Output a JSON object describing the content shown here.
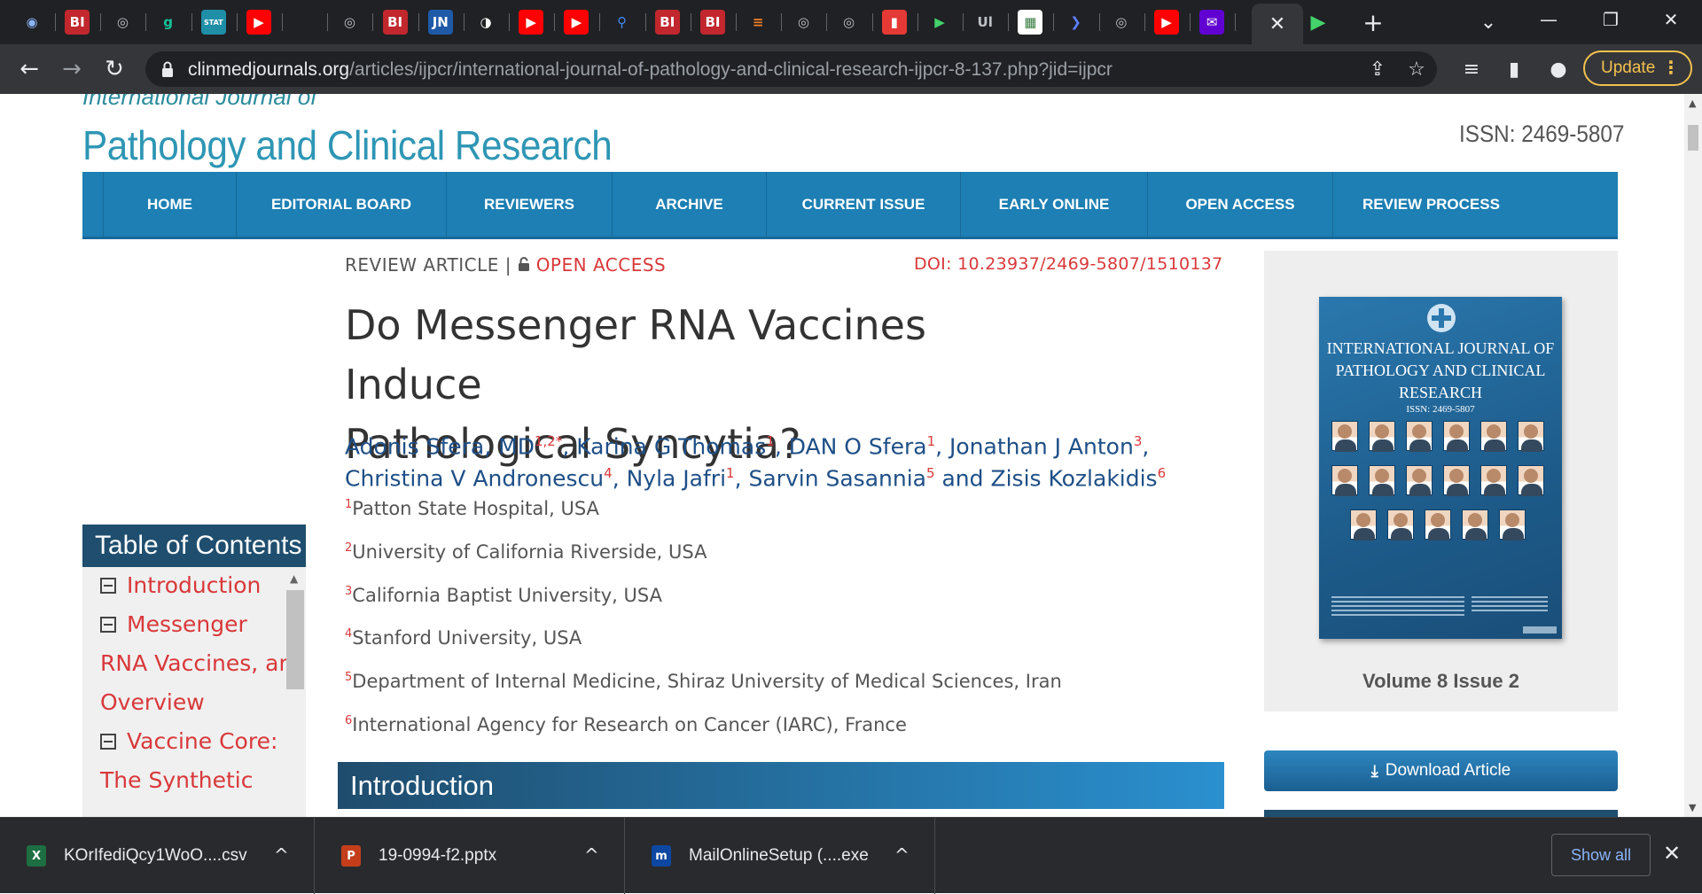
{
  "browser": {
    "tabs": [
      {
        "icon": "globe-icon",
        "glyph": "◉",
        "bg": "#202124",
        "fg": "#8ab4f8"
      },
      {
        "icon": "bi-icon",
        "glyph": "BI",
        "bg": "#c2272d",
        "fg": "#ffffff"
      },
      {
        "icon": "globe-icon",
        "glyph": "◎",
        "bg": "#202124",
        "fg": "#bdc1c6"
      },
      {
        "icon": "g-icon",
        "glyph": "g",
        "bg": "#202124",
        "fg": "#15c39a"
      },
      {
        "icon": "stat-icon",
        "glyph": "STAT",
        "bg": "#1f8fa8",
        "fg": "#ffffff"
      },
      {
        "icon": "youtube-icon",
        "glyph": "▶",
        "bg": "#ff0000",
        "fg": "#ffffff"
      },
      {
        "icon": "blank-icon",
        "glyph": "",
        "bg": "#202124",
        "fg": "#ffffff"
      },
      {
        "icon": "globe-icon",
        "glyph": "◎",
        "bg": "#202124",
        "fg": "#bdc1c6"
      },
      {
        "icon": "bi-icon",
        "glyph": "BI",
        "bg": "#c2272d",
        "fg": "#ffffff"
      },
      {
        "icon": "jn-icon",
        "glyph": "JN",
        "bg": "#1e5aa8",
        "fg": "#ffffff"
      },
      {
        "icon": "circle-icon",
        "glyph": "◑",
        "bg": "#202124",
        "fg": "#ffffff"
      },
      {
        "icon": "youtube-icon",
        "glyph": "▶",
        "bg": "#ff0000",
        "fg": "#ffffff"
      },
      {
        "icon": "youtube-icon",
        "glyph": "▶",
        "bg": "#ff0000",
        "fg": "#ffffff"
      },
      {
        "icon": "search-icon",
        "glyph": "⚲",
        "bg": "#202124",
        "fg": "#4285f4"
      },
      {
        "icon": "bi-icon",
        "glyph": "BI",
        "bg": "#c2272d",
        "fg": "#ffffff"
      },
      {
        "icon": "bi-icon",
        "glyph": "BI",
        "bg": "#c2272d",
        "fg": "#ffffff"
      },
      {
        "icon": "stack-icon",
        "glyph": "≡",
        "bg": "#202124",
        "fg": "#f48024"
      },
      {
        "icon": "globe-icon",
        "glyph": "◎",
        "bg": "#202124",
        "fg": "#bdc1c6"
      },
      {
        "icon": "globe-icon",
        "glyph": "◎",
        "bg": "#202124",
        "fg": "#bdc1c6"
      },
      {
        "icon": "mic-icon",
        "glyph": "▮",
        "bg": "#e53935",
        "fg": "#ffffff"
      },
      {
        "icon": "play-icon",
        "glyph": "▶",
        "bg": "#202124",
        "fg": "#43d36a"
      },
      {
        "icon": "ul-icon",
        "glyph": "Ul",
        "bg": "#202124",
        "fg": "#bdc1c6"
      },
      {
        "icon": "grid-icon",
        "glyph": "▦",
        "bg": "#ffffff",
        "fg": "#3a7d44"
      },
      {
        "icon": "arrow-icon",
        "glyph": "❯",
        "bg": "#202124",
        "fg": "#5b7fff"
      },
      {
        "icon": "globe-icon",
        "glyph": "◎",
        "bg": "#202124",
        "fg": "#bdc1c6"
      },
      {
        "icon": "youtube-icon",
        "glyph": "▶",
        "bg": "#ff0000",
        "fg": "#ffffff"
      },
      {
        "icon": "yahoo-icon",
        "glyph": "✉",
        "bg": "#6001d2",
        "fg": "#ffffff"
      }
    ],
    "active_tab_close": "✕",
    "after_tab_icon": {
      "icon": "play-icon",
      "glyph": "▶"
    },
    "new_tab": "+",
    "tab_search": "⌄",
    "minimize": "—",
    "restore": "❐",
    "close": "✕",
    "back": "←",
    "forward": "→",
    "reload": "↻",
    "url_host": "clinmedjournals.org",
    "url_path": "/articles/ijpcr/international-journal-of-pathology-and-clinical-research-ijpcr-8-137.php?jid=ijpcr",
    "share": "⇪",
    "bookmark": "☆",
    "media": "≡",
    "sidepanel": "▮",
    "profile": "●",
    "update_label": "Update",
    "update_menu": "⋮"
  },
  "page": {
    "journal_pre": "International Journal of",
    "journal_title": "Pathology and Clinical Research",
    "issn": "ISSN: 2469-5807",
    "nav": [
      "HOME",
      "EDITORIAL BOARD",
      "REVIEWERS",
      "ARCHIVE",
      "CURRENT ISSUE",
      "EARLY ONLINE",
      "OPEN ACCESS",
      "REVIEW PROCESS"
    ],
    "article_type": "REVIEW ARTICLE | ",
    "open_access": "OPEN ACCESS",
    "doi": "DOI: 10.23937/2469-5807/1510137",
    "title_line1": "Do Messenger RNA Vaccines Induce",
    "title_line2": "Pathological Syncytia?",
    "authors": [
      {
        "name": "Adonis Sfera, MD",
        "sup": "1,2*",
        "sep": ", "
      },
      {
        "name": "Karina G Thomas",
        "sup": "1",
        "sep": ", "
      },
      {
        "name": "DAN O Sfera",
        "sup": "1",
        "sep": ", "
      },
      {
        "name": "Jonathan J Anton",
        "sup": "3",
        "sep": ", "
      },
      {
        "name": "Christina V Andronescu",
        "sup": "4",
        "sep": ", "
      },
      {
        "name": "Nyla Jafri",
        "sup": "1",
        "sep": ", "
      },
      {
        "name": "Sarvin Sasannia",
        "sup": "5",
        "sep": " and "
      },
      {
        "name": "Zisis Kozlakidis",
        "sup": "6",
        "sep": ""
      }
    ],
    "affiliations": [
      {
        "sup": "1",
        "text": "Patton State Hospital, USA"
      },
      {
        "sup": "2",
        "text": "University of California Riverside, USA"
      },
      {
        "sup": "3",
        "text": "California Baptist University, USA"
      },
      {
        "sup": "4",
        "text": "Stanford University, USA"
      },
      {
        "sup": "5",
        "text": "Department of Internal Medicine, Shiraz University of Medical Sciences, Iran"
      },
      {
        "sup": "6",
        "text": "International Agency for Research on Cancer (IARC), France"
      }
    ],
    "section_heading": "Introduction",
    "toc_title": "Table of Contents",
    "toc_lines": [
      {
        "text": "Introduction",
        "box": true
      },
      {
        "text": "Messenger",
        "box": true
      },
      {
        "text": "RNA Vaccines, an",
        "box": false
      },
      {
        "text": "Overview",
        "box": false
      },
      {
        "text": "Vaccine Core:",
        "box": true
      },
      {
        "text": "The Synthetic",
        "box": false
      }
    ],
    "cover_title": "INTERNATIONAL JOURNAL OF PATHOLOGY AND CLINICAL RESEARCH",
    "cover_issn": "ISSN: 2469-5807",
    "volume": "Volume 8 Issue 2",
    "download_label": "Download Article"
  },
  "downloads": {
    "items": [
      {
        "name": "KOrIfediQcy1WoO....csv",
        "icon": "excel-icon",
        "glyph": "X",
        "color": "#1d6f42"
      },
      {
        "name": "19-0994-f2.pptx",
        "icon": "powerpoint-icon",
        "glyph": "P",
        "color": "#c43e1c"
      },
      {
        "name": "MailOnlineSetup (....exe",
        "icon": "mailonline-icon",
        "glyph": "m",
        "color": "#0d47a1"
      }
    ],
    "caret": "^",
    "show_all": "Show all",
    "close": "✕"
  }
}
